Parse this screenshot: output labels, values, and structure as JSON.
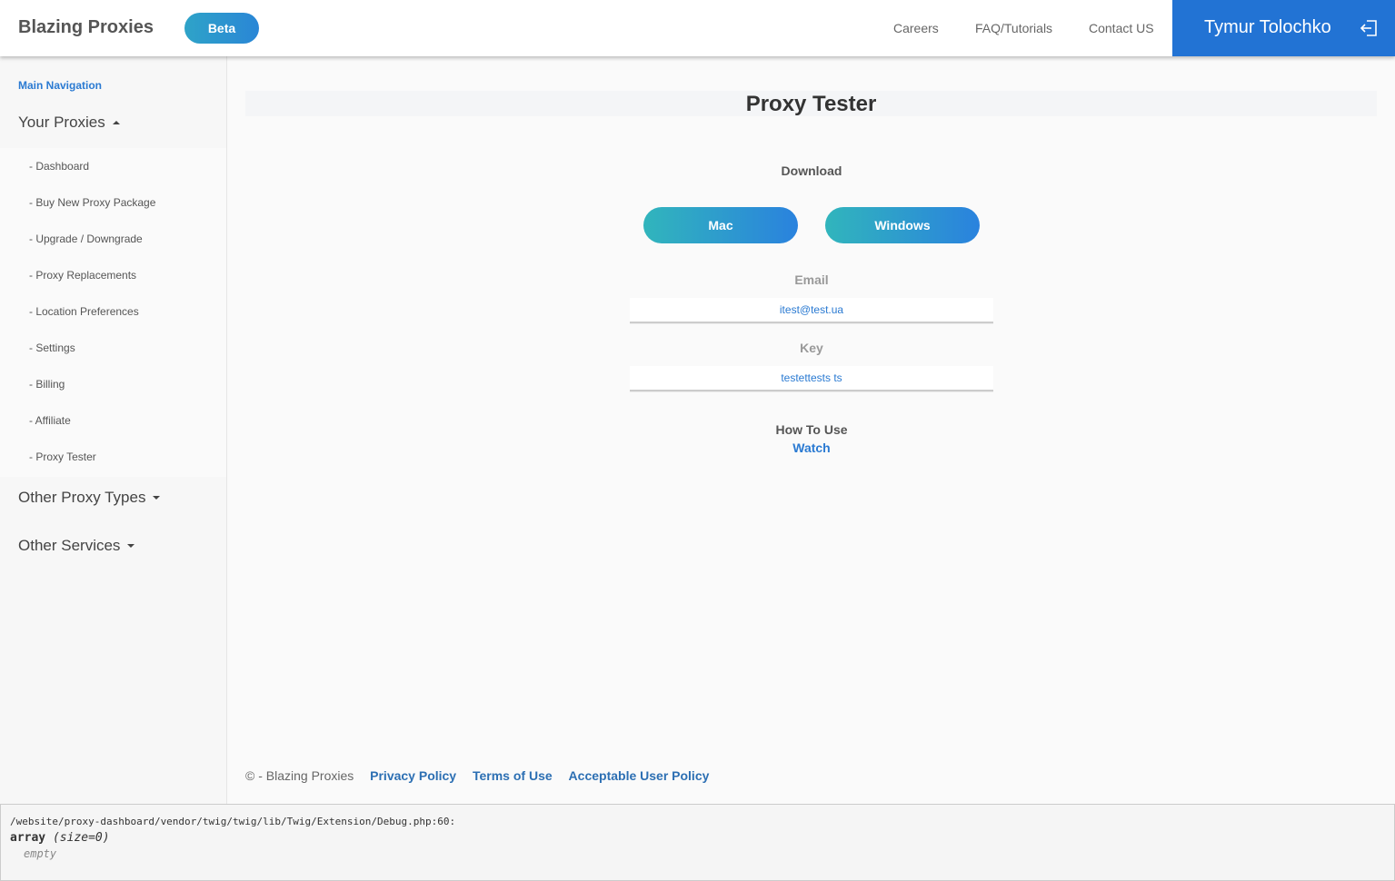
{
  "header": {
    "brand": "Blazing Proxies",
    "badge": "Beta",
    "nav": [
      "Careers",
      "FAQ/Tutorials",
      "Contact US"
    ],
    "user_name": "Tymur Tolochko",
    "logout_icon": "logout-icon",
    "accent_color": "#2273d4"
  },
  "sidebar": {
    "heading": "Main Navigation",
    "groups": [
      {
        "title": "Your Proxies",
        "expanded": true,
        "items": [
          "- Dashboard",
          "- Buy New Proxy Package",
          "- Upgrade / Downgrade",
          "- Proxy Replacements",
          "- Location Preferences",
          "- Settings",
          "- Billing",
          "- Affiliate",
          "- Proxy Tester"
        ]
      },
      {
        "title": "Other Proxy Types",
        "expanded": false
      },
      {
        "title": "Other Services",
        "expanded": false
      }
    ]
  },
  "main": {
    "title": "Proxy Tester",
    "download_label": "Download",
    "download_buttons": [
      "Mac",
      "Windows"
    ],
    "email_label": "Email",
    "email_value": "itest@test.ua",
    "key_label": "Key",
    "key_value": "testettests ts",
    "how_to_label": "How To Use",
    "how_to_link": "Watch"
  },
  "footer": {
    "copyright": "© - Blazing Proxies",
    "links": [
      "Privacy Policy",
      "Terms of Use",
      "Acceptable User Policy"
    ]
  },
  "debug": {
    "path": "/website/proxy-dashboard/vendor/twig/twig/lib/Twig/Extension/Debug.php:60:",
    "type": "array",
    "size": "(size=0)",
    "empty": "empty"
  }
}
